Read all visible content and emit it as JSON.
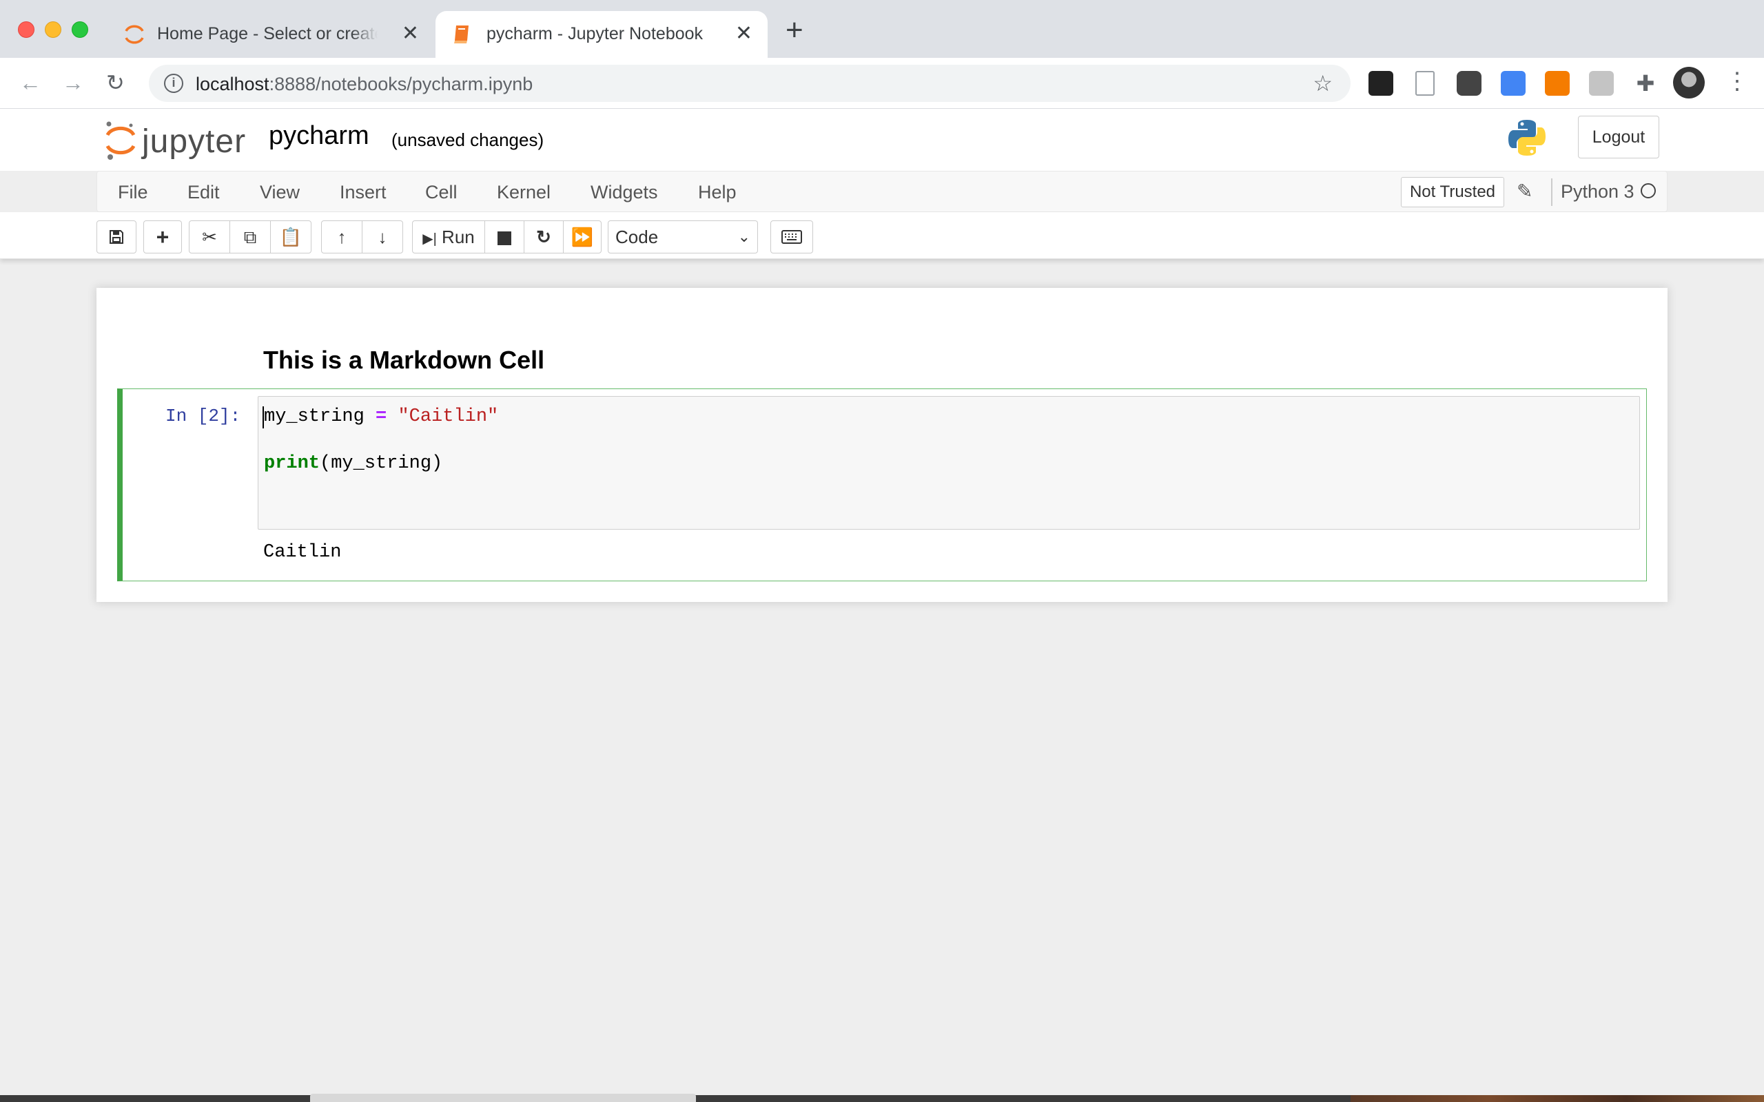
{
  "browser": {
    "tabs": [
      {
        "title": "Home Page - Select or create a notebook",
        "active": false
      },
      {
        "title": "pycharm - Jupyter Notebook",
        "active": true
      }
    ],
    "new_tab": "+",
    "url_host": "localhost",
    "url_rest": ":8888/notebooks/pycharm.ipynb",
    "close_glyph": "✕"
  },
  "jupyter": {
    "logo_text": "jupyter",
    "notebook_name": "pycharm",
    "save_status": "(unsaved changes)",
    "logout": "Logout",
    "menu": [
      "File",
      "Edit",
      "View",
      "Insert",
      "Cell",
      "Kernel",
      "Widgets",
      "Help"
    ],
    "trust": "Not Trusted",
    "kernel": "Python 3",
    "toolbar": {
      "run_label": "Run",
      "cell_type": "Code"
    }
  },
  "notebook": {
    "markdown_heading": "This is a Markdown Cell",
    "cell": {
      "prompt": "In [2]:",
      "code": {
        "var": "my_string",
        "op": "=",
        "str": "\"Caitlin\"",
        "kw": "print",
        "call": "(my_string)"
      },
      "output": "Caitlin"
    }
  },
  "colors": {
    "cell_border": "#42a545",
    "prompt": "#303f9f",
    "string": "#ba2121",
    "keyword": "#008000",
    "operator": "#aa22ff",
    "jupyter_orange": "#f37726"
  }
}
